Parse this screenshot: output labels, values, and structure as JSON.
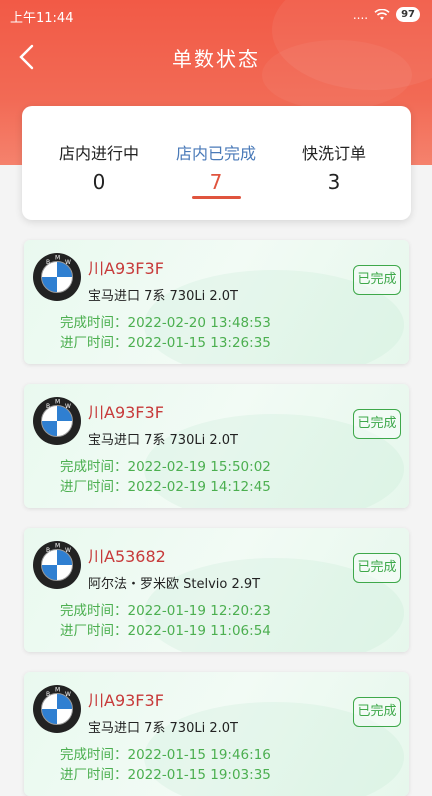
{
  "status_bar": {
    "time": "上午11:44",
    "signal": "....",
    "battery": "97"
  },
  "nav": {
    "title": "单数状态"
  },
  "tabs": [
    {
      "label": "店内进行中",
      "count": "0"
    },
    {
      "label": "店内已完成",
      "count": "7"
    },
    {
      "label": "快洗订单",
      "count": "3"
    }
  ],
  "orders": [
    {
      "plate": "川A93F3F",
      "model": "宝马进口 7系 730Li 2.0T",
      "status": "已完成",
      "complete_time": "完成时间：2022-02-20 13:48:53",
      "enter_time": "进厂时间：2022-01-15 13:26:35"
    },
    {
      "plate": "川A93F3F",
      "model": "宝马进口 7系 730Li 2.0T",
      "status": "已完成",
      "complete_time": "完成时间：2022-02-19 15:50:02",
      "enter_time": "进厂时间：2022-02-19 14:12:45"
    },
    {
      "plate": "川A53682",
      "model": "阿尔法・罗米欧 Stelvio 2.9T",
      "status": "已完成",
      "complete_time": "完成时间：2022-01-19 12:20:23",
      "enter_time": "进厂时间：2022-01-19 11:06:54"
    },
    {
      "plate": "川A93F3F",
      "model": "宝马进口 7系 730Li 2.0T",
      "status": "已完成",
      "complete_time": "完成时间：2022-01-15 19:46:16",
      "enter_time": "进厂时间：2022-01-15 19:03:35"
    }
  ],
  "colors": {
    "header": "#f25a46",
    "plate": "#c73a3a",
    "done": "#3ea84a",
    "active_tab": "#4a7ab8"
  }
}
